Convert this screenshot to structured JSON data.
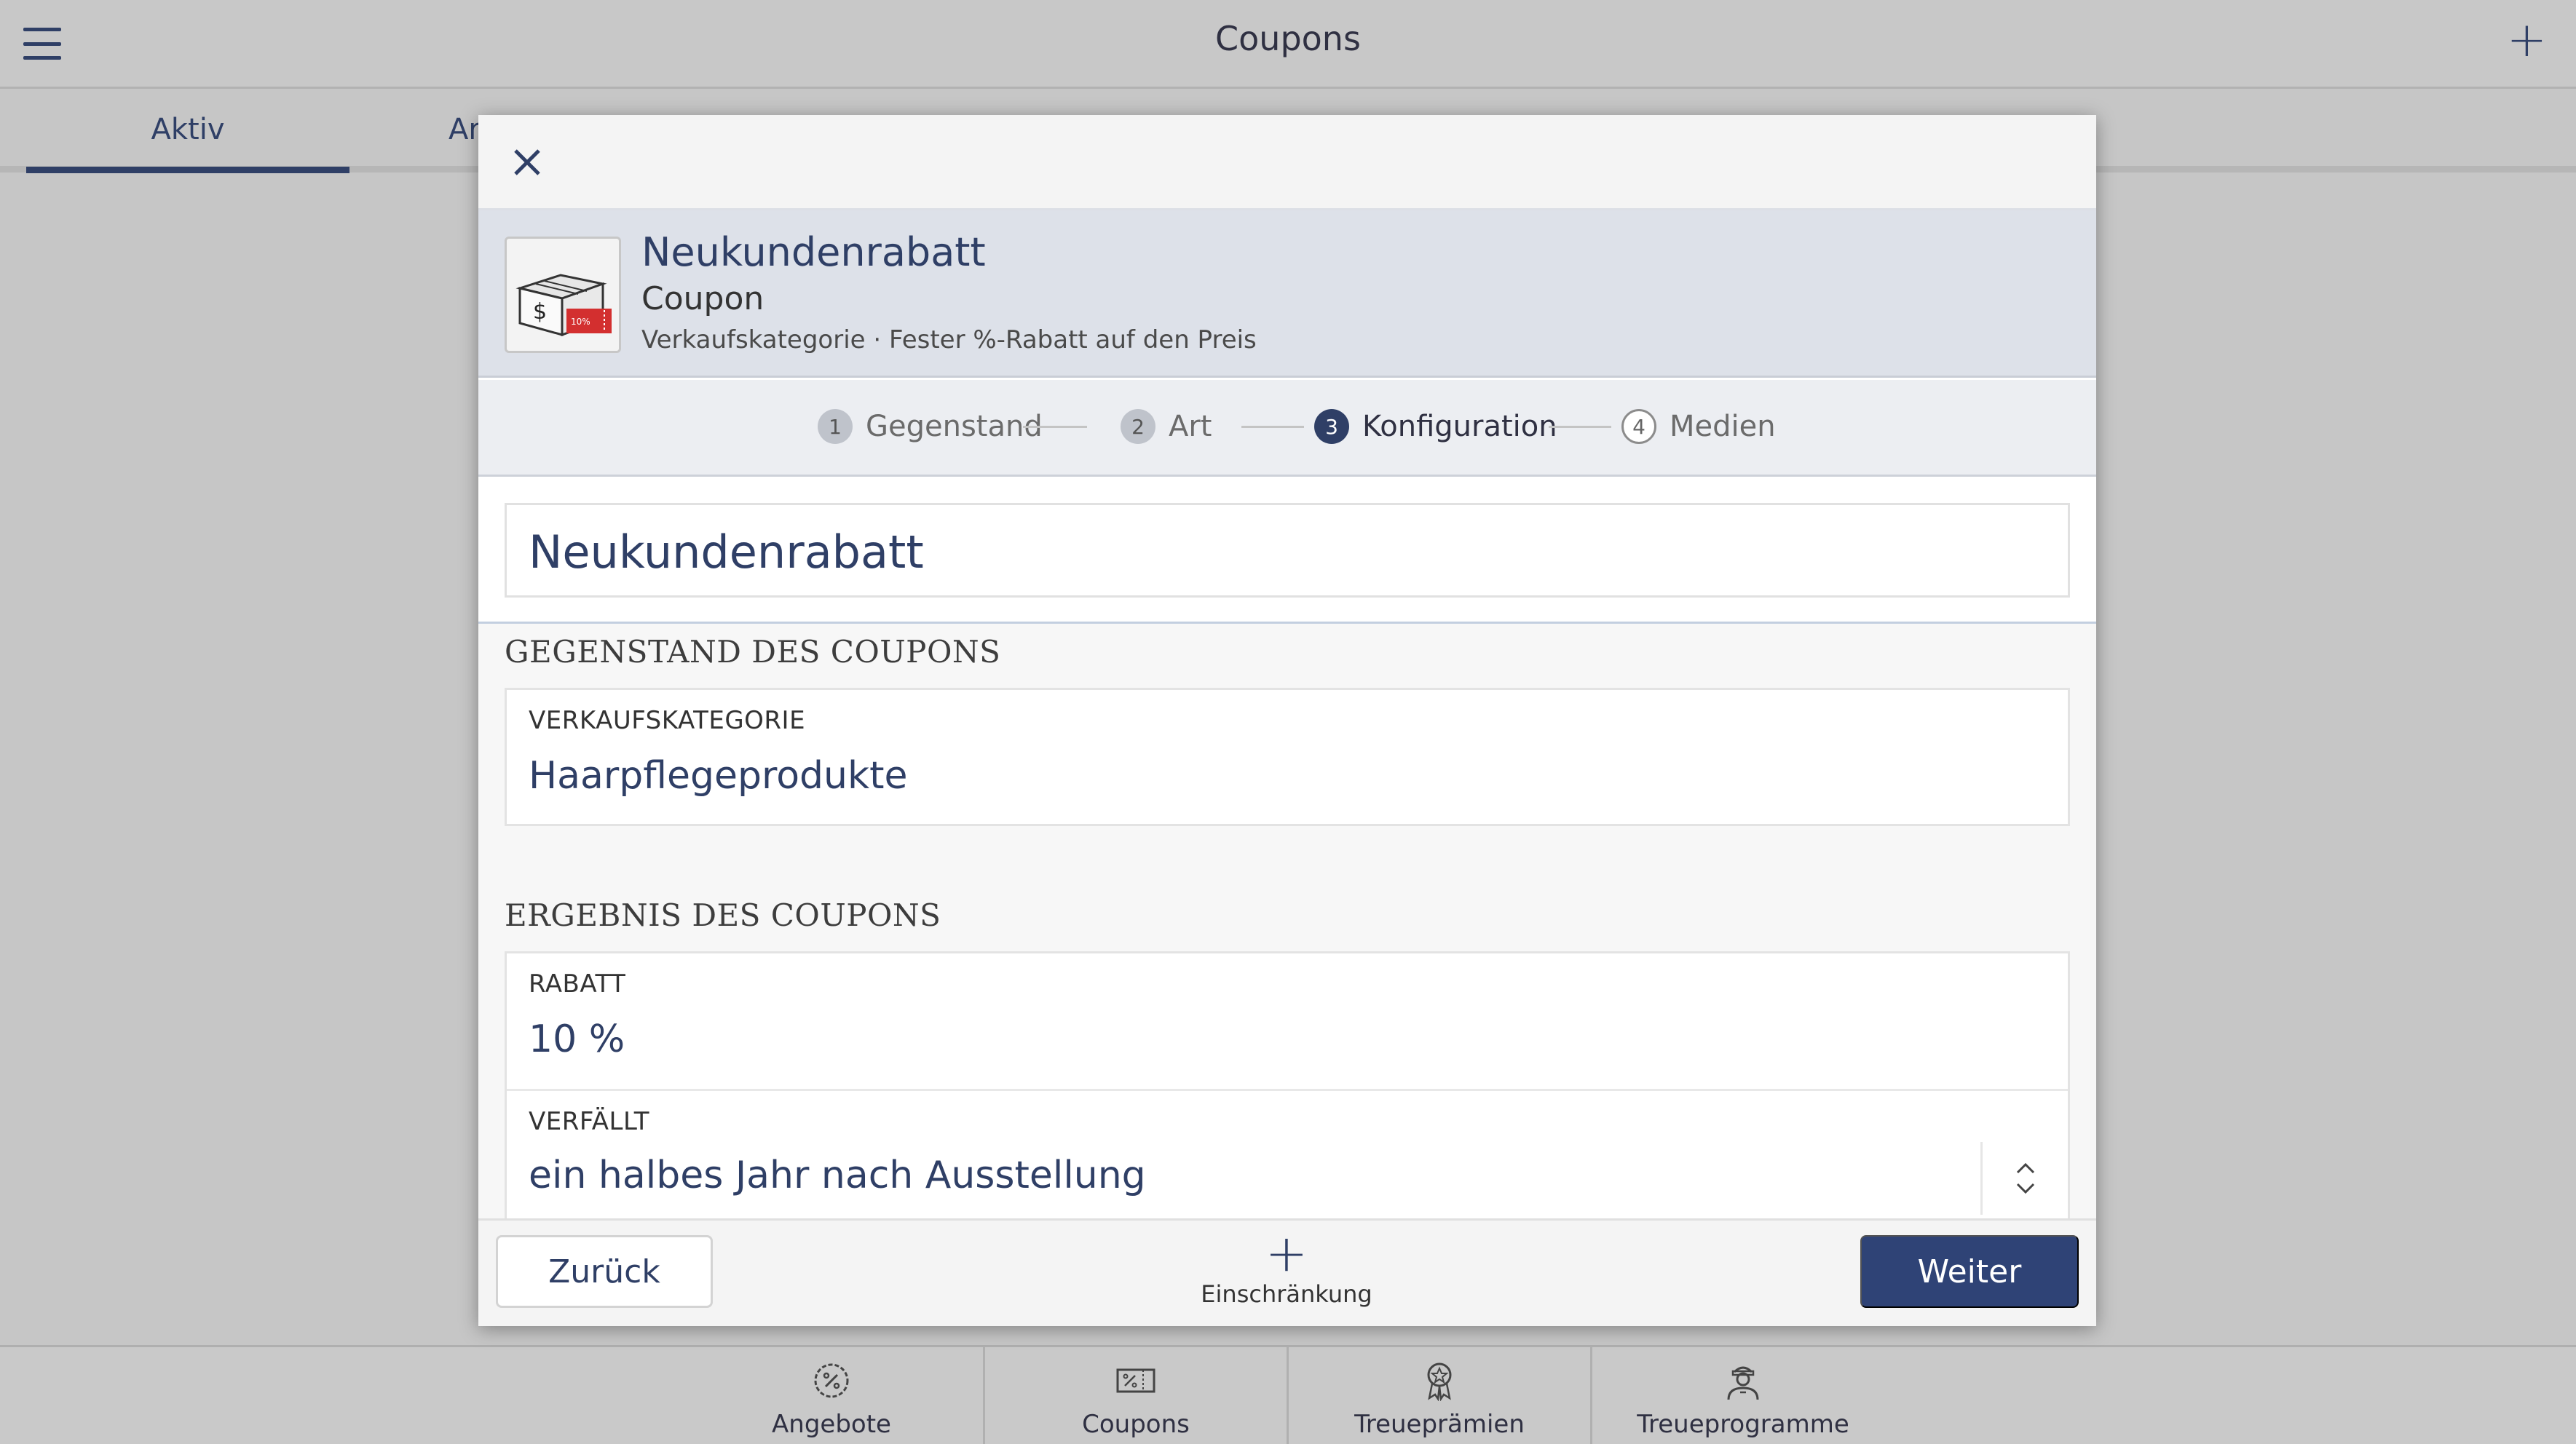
{
  "app": {
    "title": "Coupons",
    "tabs": [
      {
        "label": "Aktiv",
        "active": true
      },
      {
        "label": "Ar",
        "active": false
      }
    ]
  },
  "bottom_nav": [
    {
      "label": "Angebote",
      "icon": "percent-circle-icon"
    },
    {
      "label": "Coupons",
      "icon": "coupon-icon",
      "active": true
    },
    {
      "label": "Treueprämien",
      "icon": "award-ribbon-icon"
    },
    {
      "label": "Treueprogramme",
      "icon": "person-badge-icon"
    }
  ],
  "modal": {
    "header": {
      "title": "Neukundenrabatt",
      "type": "Coupon",
      "description": "Verkaufskategorie · Fester %-Rabatt auf den Preis",
      "thumbnail_badge": "10%"
    },
    "steps": [
      {
        "num": "1",
        "label": "Gegenstand",
        "state": "done"
      },
      {
        "num": "2",
        "label": "Art",
        "state": "done"
      },
      {
        "num": "3",
        "label": "Konfiguration",
        "state": "active"
      },
      {
        "num": "4",
        "label": "Medien",
        "state": "future"
      }
    ],
    "name_value": "Neukundenrabatt",
    "section_subject": {
      "title": "GEGENSTAND DES COUPONS",
      "field_label": "VERKAUFSKATEGORIE",
      "field_value": "Haarpflegeprodukte"
    },
    "section_result": {
      "title": "ERGEBNIS DES COUPONS",
      "discount_label": "RABATT",
      "discount_value": "10 %",
      "expiry_label": "VERFÄLLT",
      "expiry_value": "ein halbes Jahr nach Ausstellung"
    },
    "footer": {
      "back_label": "Zurück",
      "add_restriction_label": "Einschränkung",
      "next_label": "Weiter"
    }
  },
  "colors": {
    "accent": "#2f3f66",
    "primary_button": "#2f4376",
    "overlay_bg": "#c6c6c6"
  }
}
